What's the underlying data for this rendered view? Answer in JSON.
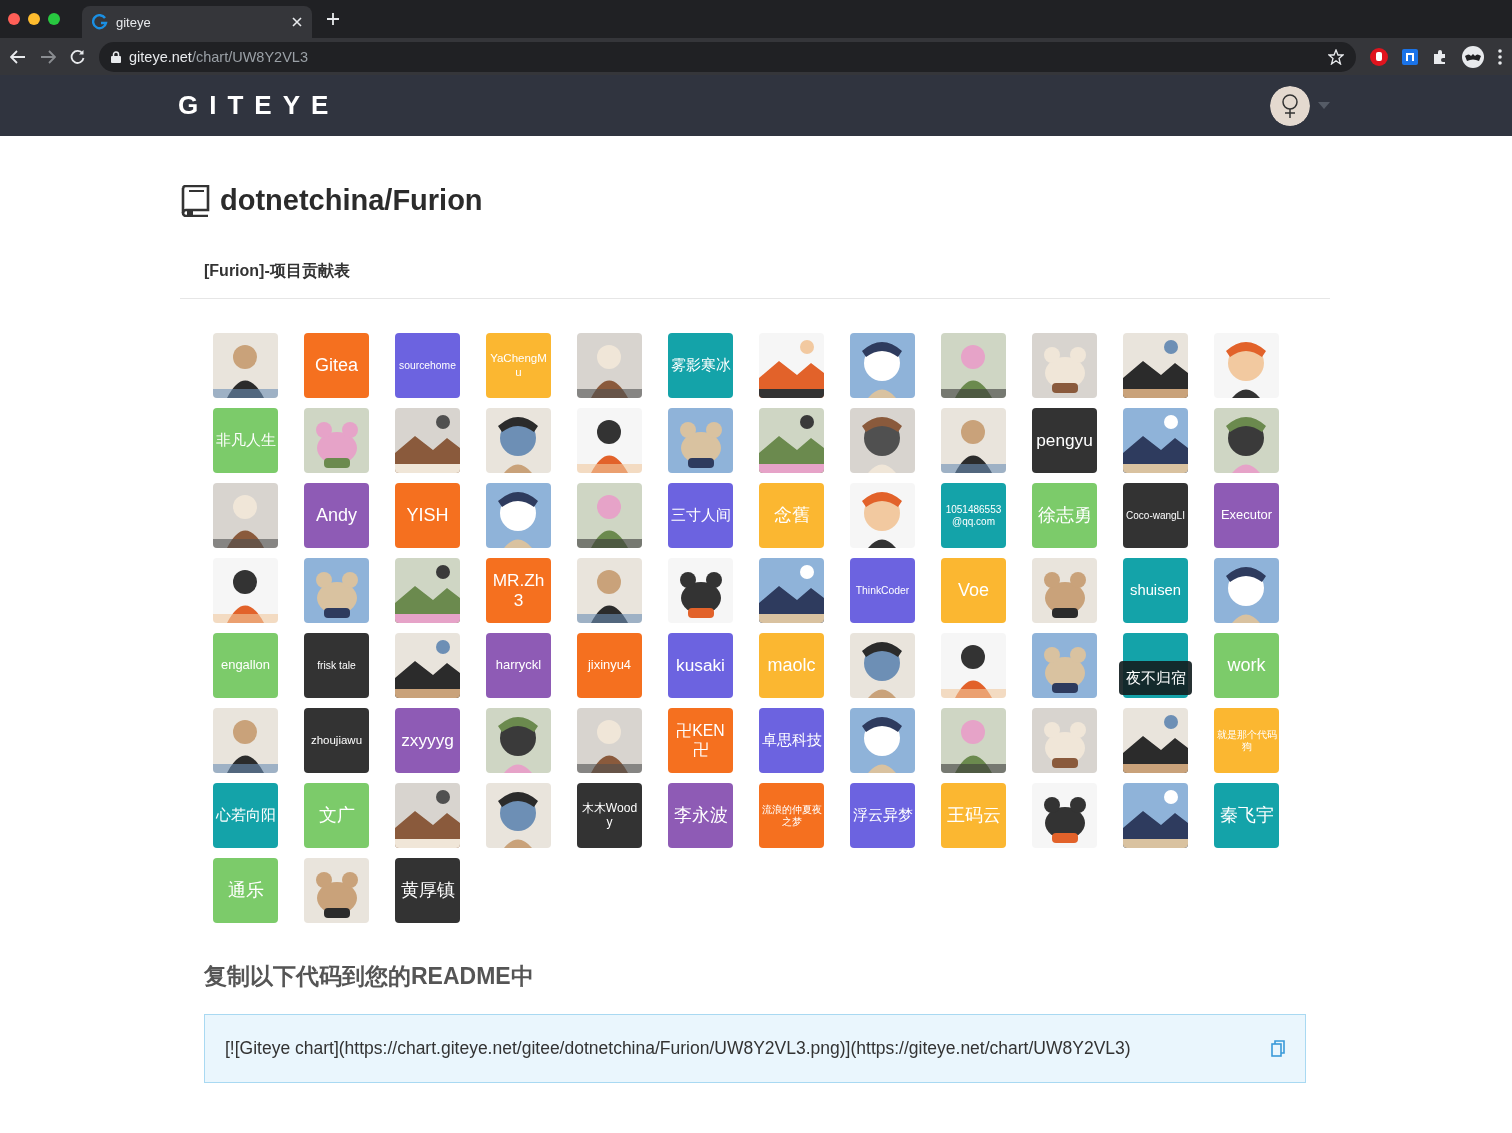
{
  "browser": {
    "tab_title": "giteye",
    "url_host": "giteye.net",
    "url_path": "/chart/UW8Y2VL3"
  },
  "site": {
    "logo": "GITEYE"
  },
  "repo": {
    "title": "dotnetchina/Furion",
    "subtitle": "[Furion]-项目贡献表"
  },
  "contributors": [
    {
      "kind": "picture"
    },
    {
      "kind": "text",
      "label": "Gitea",
      "color": "#f5701f"
    },
    {
      "kind": "text",
      "label": "sourcehome",
      "color": "#6c63e0"
    },
    {
      "kind": "text",
      "label": "YaChengMu",
      "color": "#fbb731"
    },
    {
      "kind": "picture"
    },
    {
      "kind": "text",
      "label": "雾影寒冰",
      "color": "#14a3a9"
    },
    {
      "kind": "picture"
    },
    {
      "kind": "picture"
    },
    {
      "kind": "picture"
    },
    {
      "kind": "picture"
    },
    {
      "kind": "picture"
    },
    {
      "kind": "picture"
    },
    {
      "kind": "text",
      "label": "非凡人生",
      "color": "#7ccb6a"
    },
    {
      "kind": "picture"
    },
    {
      "kind": "picture"
    },
    {
      "kind": "picture"
    },
    {
      "kind": "picture"
    },
    {
      "kind": "picture"
    },
    {
      "kind": "picture"
    },
    {
      "kind": "picture"
    },
    {
      "kind": "picture"
    },
    {
      "kind": "text",
      "label": "pengyu",
      "color": "#333333"
    },
    {
      "kind": "picture"
    },
    {
      "kind": "picture"
    },
    {
      "kind": "picture"
    },
    {
      "kind": "text",
      "label": "Andy",
      "color": "#8e5bb5"
    },
    {
      "kind": "text",
      "label": "YISH",
      "color": "#f5701f"
    },
    {
      "kind": "picture"
    },
    {
      "kind": "picture"
    },
    {
      "kind": "text",
      "label": "三寸人间",
      "color": "#6c63e0"
    },
    {
      "kind": "text",
      "label": "念舊",
      "color": "#fbb731"
    },
    {
      "kind": "picture"
    },
    {
      "kind": "text",
      "label": "1051486553@qq.com",
      "color": "#14a3a9"
    },
    {
      "kind": "text",
      "label": "徐志勇",
      "color": "#7ccb6a"
    },
    {
      "kind": "text",
      "label": "Coco-wangLI",
      "color": "#333333"
    },
    {
      "kind": "text",
      "label": "Executor",
      "color": "#8e5bb5"
    },
    {
      "kind": "picture"
    },
    {
      "kind": "picture"
    },
    {
      "kind": "picture"
    },
    {
      "kind": "text",
      "label": "MR.Zh3",
      "color": "#f5701f"
    },
    {
      "kind": "picture"
    },
    {
      "kind": "picture"
    },
    {
      "kind": "picture"
    },
    {
      "kind": "text",
      "label": "ThinkCoder",
      "color": "#6c63e0"
    },
    {
      "kind": "text",
      "label": "Voe",
      "color": "#fbb731"
    },
    {
      "kind": "picture"
    },
    {
      "kind": "text",
      "label": "shuisen",
      "color": "#14a3a9"
    },
    {
      "kind": "picture"
    },
    {
      "kind": "text",
      "label": "engallon",
      "color": "#7ccb6a"
    },
    {
      "kind": "text",
      "label": "frisk tale",
      "color": "#333333"
    },
    {
      "kind": "picture"
    },
    {
      "kind": "text",
      "label": "harryckl",
      "color": "#8e5bb5"
    },
    {
      "kind": "text",
      "label": "jixinyu4",
      "color": "#f5701f"
    },
    {
      "kind": "text",
      "label": "kusaki",
      "color": "#6c63e0"
    },
    {
      "kind": "text",
      "label": "maolc",
      "color": "#fbb731"
    },
    {
      "kind": "picture"
    },
    {
      "kind": "picture"
    },
    {
      "kind": "picture"
    },
    {
      "kind": "text",
      "color": "#14a3a9",
      "tooltip": "夜不归宿"
    },
    {
      "kind": "text",
      "label": "work",
      "color": "#7ccb6a"
    },
    {
      "kind": "picture"
    },
    {
      "kind": "text",
      "label": "zhoujiawu",
      "color": "#333333"
    },
    {
      "kind": "text",
      "label": "zxyyyg",
      "color": "#8e5bb5"
    },
    {
      "kind": "picture"
    },
    {
      "kind": "picture"
    },
    {
      "kind": "text",
      "label": "卍KEN卍",
      "color": "#f5701f"
    },
    {
      "kind": "text",
      "label": "卓思科技",
      "color": "#6c63e0"
    },
    {
      "kind": "picture"
    },
    {
      "kind": "picture"
    },
    {
      "kind": "picture"
    },
    {
      "kind": "picture"
    },
    {
      "kind": "text",
      "label": "就是那个代码狗",
      "color": "#fbb731"
    },
    {
      "kind": "text",
      "label": "心若向阳",
      "color": "#14a3a9"
    },
    {
      "kind": "text",
      "label": "文广",
      "color": "#7ccb6a"
    },
    {
      "kind": "picture"
    },
    {
      "kind": "picture"
    },
    {
      "kind": "text",
      "label": "木木Woody",
      "color": "#333333"
    },
    {
      "kind": "text",
      "label": "李永波",
      "color": "#8e5bb5"
    },
    {
      "kind": "text",
      "label": "流浪的仲夏夜之梦",
      "color": "#f5701f"
    },
    {
      "kind": "text",
      "label": "浮云异梦",
      "color": "#6c63e0"
    },
    {
      "kind": "text",
      "label": "王码云",
      "color": "#fbb731"
    },
    {
      "kind": "picture"
    },
    {
      "kind": "picture"
    },
    {
      "kind": "text",
      "label": "秦飞宇",
      "color": "#14a3a9"
    },
    {
      "kind": "text",
      "label": "通乐",
      "color": "#7ccb6a"
    },
    {
      "kind": "picture"
    },
    {
      "kind": "text",
      "label": "黄厚镇",
      "color": "#333333"
    }
  ],
  "readme": {
    "heading": "复制以下代码到您的README中",
    "code": "[![Giteye chart](https://chart.giteye.net/gitee/dotnetchina/Furion/UW8Y2VL3.png)](https://giteye.net/chart/UW8Y2VL3)"
  }
}
